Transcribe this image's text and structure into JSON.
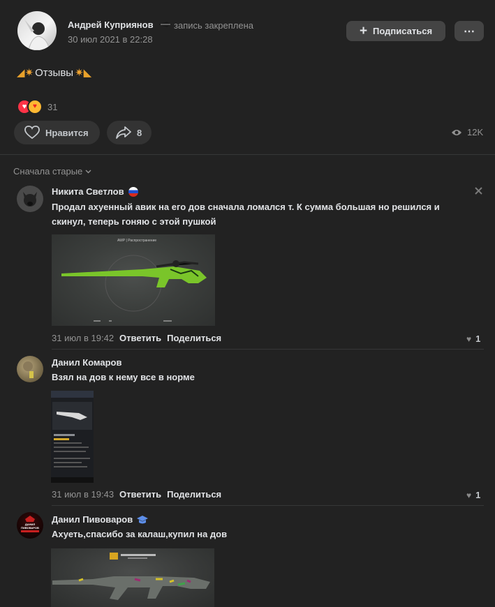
{
  "post": {
    "author": "Андрей Куприянов",
    "pinned_label": "запись закреплена",
    "date": "30 июл 2021 в 22:28",
    "subscribe_label": "Подписаться",
    "more_label": "⋯",
    "title": "Отзывы",
    "reactions_count": "31",
    "like_label": "Нравится",
    "shares_count": "8",
    "views_count": "12K"
  },
  "sort_label": "Сначала старые",
  "comments": [
    {
      "author": "Никита Светлов",
      "text": "Продал ахуенный авик на его дов сначала ломался т. К сумма большая но решился и скинул, теперь гоняю с этой пушкой",
      "time": "31 июл в 19:42",
      "reply_label": "Ответить",
      "share_label": "Поделиться",
      "likes": "1",
      "image_caption": "AWP | Распространение"
    },
    {
      "author": "Данил Комаров",
      "text": "Взял на дов к нему все в норме",
      "time": "31 июл в 19:43",
      "reply_label": "Ответить",
      "share_label": "Поделиться",
      "likes": "1"
    },
    {
      "author": "Данил Пивоваров",
      "text": "Ахуеть,спасибо за калаш,купил на дов",
      "avatar_text": "ДАНИЛ ПИВОВАРОВ"
    }
  ],
  "colors": {
    "background": "#222222",
    "accent_red": "#ff3347",
    "text_primary": "#e1e3e6",
    "text_muted": "#939393",
    "button_bg": "#3a3a3a"
  }
}
